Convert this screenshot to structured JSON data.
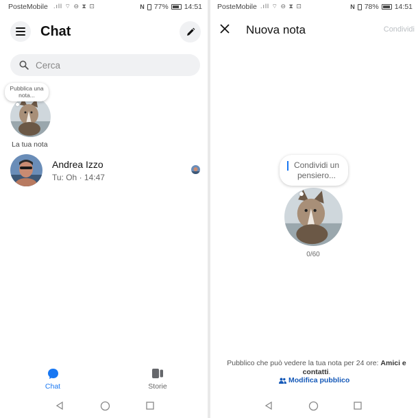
{
  "status_left": {
    "carrier": "PosteMobile",
    "battery": "77%",
    "battery_level": 0.77,
    "time": "14:51"
  },
  "status_right": {
    "carrier": "PosteMobile",
    "battery": "78%",
    "battery_level": 0.78,
    "time": "14:51"
  },
  "chat_screen": {
    "title": "Chat",
    "search": {
      "placeholder": "Cerca"
    },
    "note": {
      "bubble_text": "Pubblica una nota...",
      "label": "La tua nota"
    },
    "conversations": [
      {
        "name": "Andrea Izzo",
        "preview": "Tu: Oh · 14:47"
      }
    ],
    "nav": {
      "chat": "Chat",
      "storie": "Storie"
    }
  },
  "note_screen": {
    "title": "Nuova nota",
    "share_label": "Condividi",
    "bubble_placeholder": "Condividi un pensiero...",
    "counter": "0/60",
    "audience_text": "Pubblico che può vedere la tua nota per 24 ore:",
    "audience_value": "Amici e contatti",
    "audience_suffix": ".",
    "edit_audience": "Modifica pubblico"
  },
  "colors": {
    "accent": "#1877f2",
    "link": "#1559b8",
    "disabled": "#bcc0c4",
    "chip_bg": "#f0f1f3"
  }
}
